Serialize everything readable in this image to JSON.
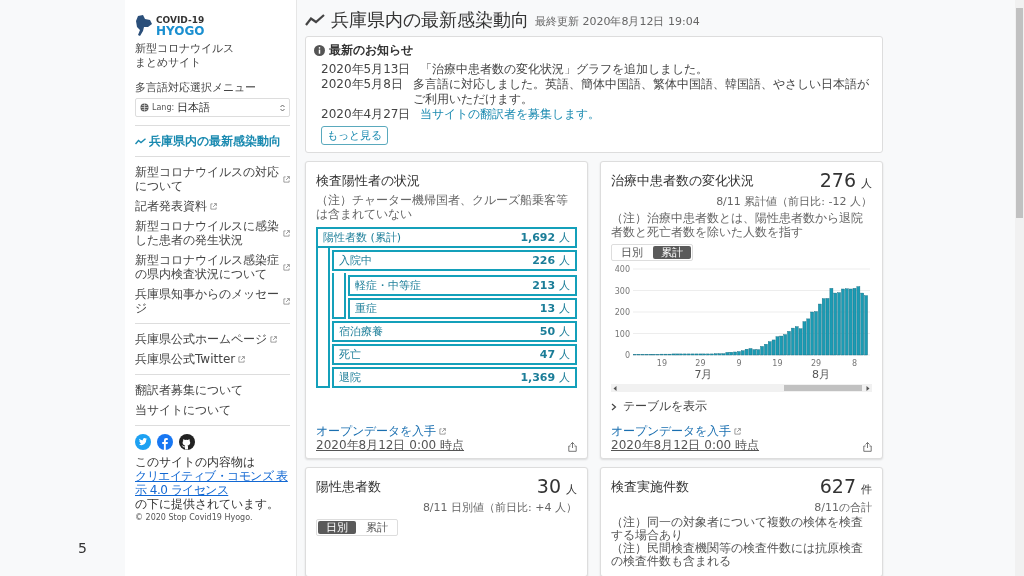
{
  "page_number": "5",
  "sidebar": {
    "logo": {
      "line1": "COVID-19",
      "line2": "HYOGO"
    },
    "site_name_lines": [
      "新型コロナウイルス",
      "まとめサイト"
    ],
    "language_menu": {
      "label": "多言語対応選択メニュー",
      "prefix": "Lang:",
      "value": "日本語"
    },
    "nav_groups": [
      [
        {
          "label": "兵庫県内の最新感染動向",
          "kind": "internal",
          "selected": true
        }
      ],
      [
        {
          "label": "新型コロナウイルスの対応について",
          "kind": "external",
          "selected": false
        },
        {
          "label": "記者発表資料",
          "kind": "external",
          "selected": false
        },
        {
          "label": "新型コロナウイルスに感染した患者の発生状況",
          "kind": "external",
          "selected": false
        },
        {
          "label": "新型コロナウイルス感染症の県内検査状況について",
          "kind": "external",
          "selected": false
        },
        {
          "label": "兵庫県知事からのメッセージ",
          "kind": "external",
          "selected": false
        }
      ],
      [
        {
          "label": "兵庫県公式ホームページ",
          "kind": "external",
          "selected": false
        },
        {
          "label": "兵庫県公式Twitter",
          "kind": "external",
          "selected": false
        }
      ],
      [
        {
          "label": "翻訳者募集について",
          "kind": "internal",
          "selected": false
        },
        {
          "label": "当サイトについて",
          "kind": "internal",
          "selected": false
        }
      ]
    ],
    "license": {
      "before": "このサイトの内容物は",
      "link": "クリエイティブ・コモンズ 表示 4.0 ライセンス",
      "after": "の下に提供されています。"
    },
    "copyright": "© 2020 Stop Covid19 Hyogo."
  },
  "header": {
    "title": "兵庫県内の最新感染動向",
    "updated": "最終更新 2020年8月12日 19:04"
  },
  "news": {
    "title": "最新のお知らせ",
    "items": [
      {
        "date": "2020年5月13日",
        "text": "「治療中患者数の変化状況」グラフを追加しました。",
        "kind": "text"
      },
      {
        "date": "2020年5月8日",
        "text": "多言語に対応しました。英語、簡体中国語、繁体中国語、韓国語、やさしい日本語がご利用いただけます。",
        "kind": "text"
      },
      {
        "date": "2020年4月27日",
        "text": "当サイトの翻訳者を募集します。",
        "kind": "link"
      }
    ],
    "more_button": "もっと見る"
  },
  "positives_card": {
    "title": "検査陽性者の状況",
    "note": "（注）チャーター機帰国者、クルーズ船乗客等は含まれていない",
    "tree": {
      "label": "陽性者数 (累計)",
      "value": "1,692",
      "unit": "人",
      "children": [
        {
          "label": "入院中",
          "value": "226",
          "unit": "人",
          "children": [
            {
              "label": "軽症・中等症",
              "value": "213",
              "unit": "人"
            },
            {
              "label": "重症",
              "value": "13",
              "unit": "人"
            }
          ]
        },
        {
          "label": "宿泊療養",
          "value": "50",
          "unit": "人"
        },
        {
          "label": "死亡",
          "value": "47",
          "unit": "人"
        },
        {
          "label": "退院",
          "value": "1,369",
          "unit": "人"
        }
      ]
    },
    "open_data": "オープンデータを入手",
    "as_of": "2020年8月12日 0:00 時点"
  },
  "patients_card": {
    "title": "治療中患者数の変化状況",
    "value": "276",
    "unit": "人",
    "sub": "8/11 累計値（前日比: -12 人）",
    "note": "（注）治療中患者数とは、陽性患者数から退院者数と死亡者数を除いた人数を指す",
    "toggle": [
      {
        "label": "日別",
        "selected": false
      },
      {
        "label": "累計",
        "selected": true
      }
    ],
    "chart_data": {
      "type": "bar",
      "categories": [
        null,
        null,
        null,
        null,
        null,
        null,
        null,
        "19",
        null,
        null,
        null,
        null,
        null,
        null,
        null,
        null,
        null,
        "29",
        null,
        null,
        null,
        null,
        null,
        null,
        null,
        null,
        null,
        "9",
        null,
        null,
        null,
        null,
        null,
        null,
        null,
        null,
        null,
        "19",
        null,
        null,
        null,
        null,
        null,
        null,
        null,
        null,
        null,
        "29",
        null,
        null,
        null,
        null,
        null,
        null,
        null,
        null,
        null,
        "8",
        null,
        null,
        null
      ],
      "values": [
        3,
        3,
        3,
        3,
        3,
        3,
        3,
        4,
        4,
        4,
        5,
        5,
        5,
        5,
        5,
        5,
        5,
        5,
        5,
        5,
        5,
        6,
        6,
        6,
        12,
        13,
        14,
        16,
        20,
        27,
        30,
        25,
        25,
        40,
        50,
        62,
        70,
        85,
        88,
        95,
        110,
        125,
        132,
        122,
        155,
        168,
        200,
        202,
        237,
        262,
        263,
        310,
        288,
        290,
        307,
        308,
        307,
        310,
        318,
        288,
        276
      ],
      "ylim": [
        0,
        400
      ],
      "yticks": [
        0,
        100,
        200,
        300,
        400
      ],
      "grid": true
    },
    "month_labels": [
      "7月",
      "8月"
    ],
    "table_toggle": {
      "label": "テーブルを表示",
      "expanded": false
    },
    "open_data": "オープンデータを入手",
    "as_of": "2020年8月12日 0:00 時点"
  },
  "daily_card": {
    "title": "陽性患者数",
    "value": "30",
    "unit": "人",
    "sub": "8/11 日別値（前日比: +4 人）",
    "toggle": [
      {
        "label": "日別",
        "selected": true
      },
      {
        "label": "累計",
        "selected": false
      }
    ]
  },
  "tests_card": {
    "title": "検査実施件数",
    "value": "627",
    "unit": "件",
    "sub": "8/11の合計",
    "notes": [
      "（注）同一の対象者について複数の検体を検査する場合あり",
      "（注）民間検査機関等の検査件数には抗原検査の検査件数も含まれる"
    ]
  }
}
